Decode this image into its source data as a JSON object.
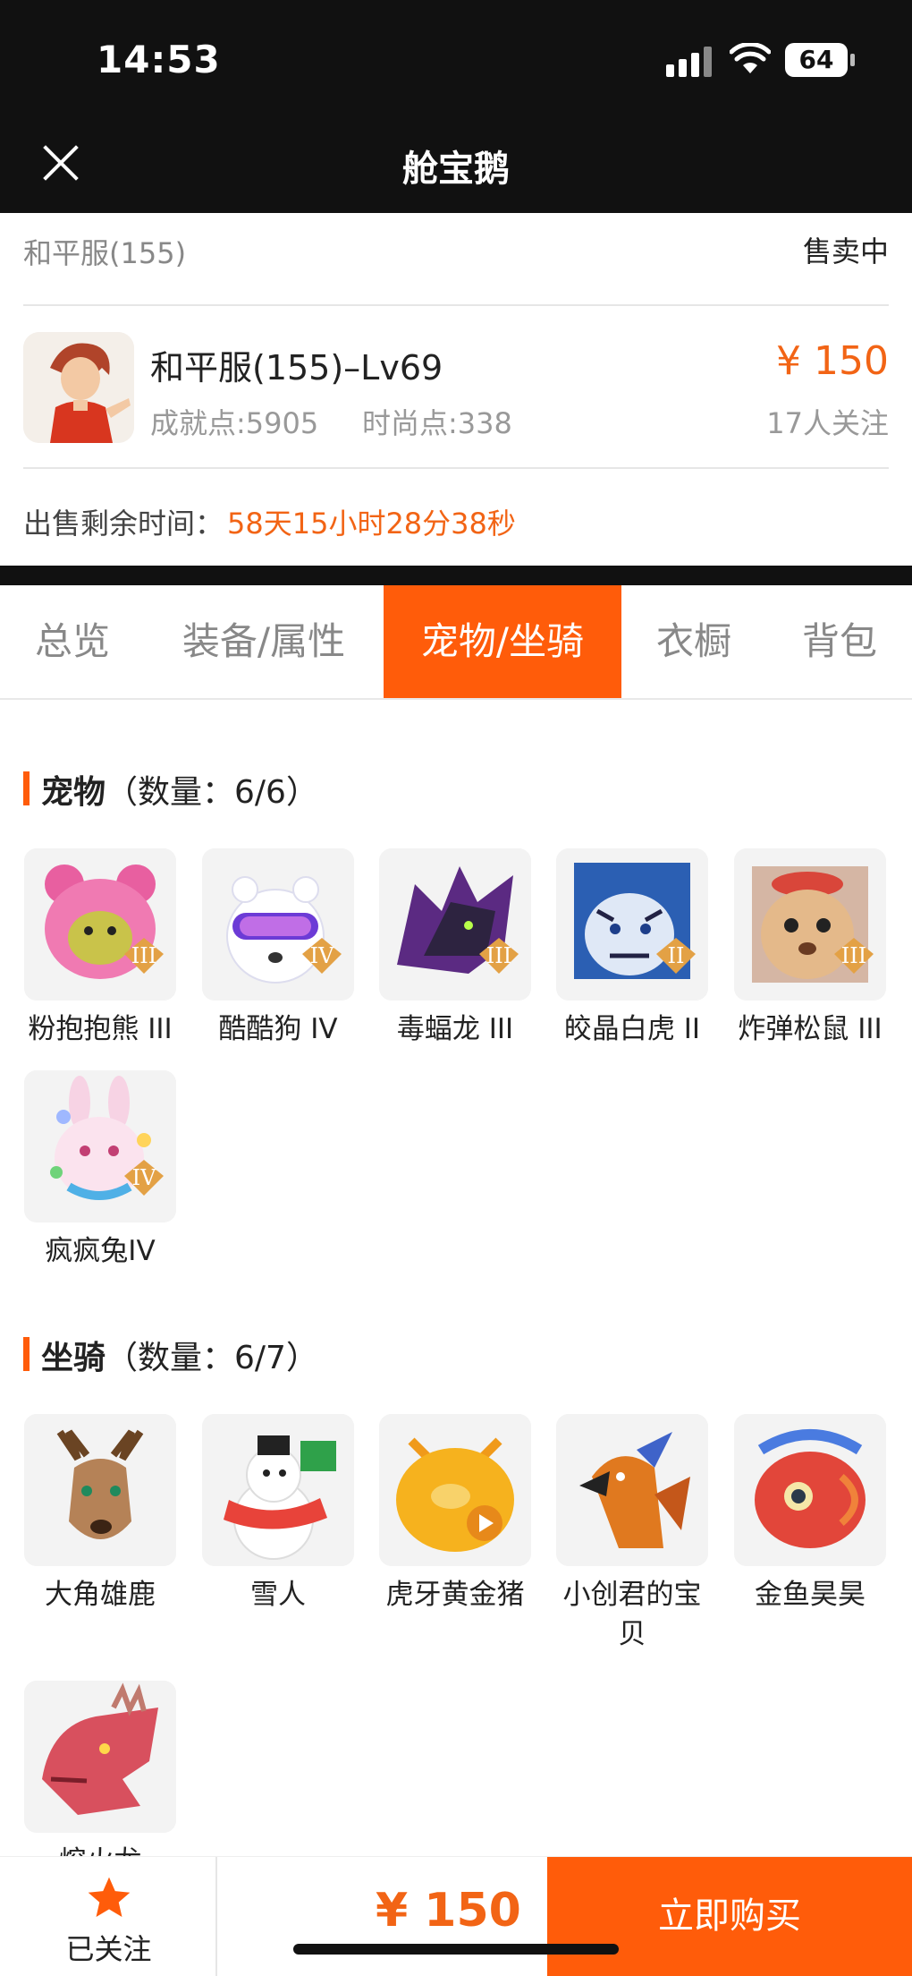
{
  "status_bar": {
    "time": "14:53",
    "battery": "64"
  },
  "nav": {
    "title": "舱宝鹅"
  },
  "listing": {
    "server": "和平服(155)",
    "status": "售卖中",
    "role_name": "和平服(155)–Lv69",
    "achievement": "成就点:5905",
    "fashion": "时尚点:338",
    "price": "¥ 150",
    "followers": "17人关注",
    "remain_label": "出售剩余时间：",
    "remain_value": "58天15小时28分38秒"
  },
  "tabs": [
    {
      "label": "总览",
      "active": false
    },
    {
      "label": "装备/属性",
      "active": false
    },
    {
      "label": "宠物/坐骑",
      "active": true
    },
    {
      "label": "衣橱",
      "active": false
    },
    {
      "label": "背包",
      "active": false
    }
  ],
  "pets": {
    "title": "宠物",
    "count": "（数量：6/6）",
    "items": [
      {
        "name": "粉抱抱熊 III",
        "icon": "pink-bear-icon",
        "color": "#f06da8"
      },
      {
        "name": "酷酷狗 IV",
        "icon": "cool-dog-icon",
        "color": "#e9eef5"
      },
      {
        "name": "毒蝠龙 III",
        "icon": "poison-bat-dragon-icon",
        "color": "#6a2c8f"
      },
      {
        "name": "皎晶白虎 II",
        "icon": "white-tiger-icon",
        "color": "#3f7fd6"
      },
      {
        "name": "炸弹松鼠 III",
        "icon": "bomb-squirrel-icon",
        "color": "#d9a46a"
      },
      {
        "name": "疯疯兔IV",
        "icon": "crazy-rabbit-icon",
        "color": "#f5c6dc"
      }
    ]
  },
  "mounts": {
    "title": "坐骑",
    "count": "（数量：6/7）",
    "items": [
      {
        "name": "大角雄鹿",
        "icon": "antler-deer-icon",
        "color": "#a8774f"
      },
      {
        "name": "雪人",
        "icon": "snowman-icon",
        "color": "#e8433a"
      },
      {
        "name": "虎牙黄金猪",
        "icon": "golden-pig-icon",
        "color": "#f6b21e"
      },
      {
        "name": "小创君的宝贝",
        "icon": "phoenix-bird-icon",
        "color": "#e0791f"
      },
      {
        "name": "金鱼昊昊",
        "icon": "goldfish-icon",
        "color": "#e2463a"
      },
      {
        "name": "熔火龙",
        "icon": "lava-dragon-icon",
        "color": "#d8505e"
      }
    ]
  },
  "bottom": {
    "follow_label": "已关注",
    "price": "¥ 150",
    "buy_label": "立即购买"
  },
  "colors": {
    "accent": "#ff5c0a",
    "price": "#f26415",
    "star": "#ff5c0a"
  }
}
